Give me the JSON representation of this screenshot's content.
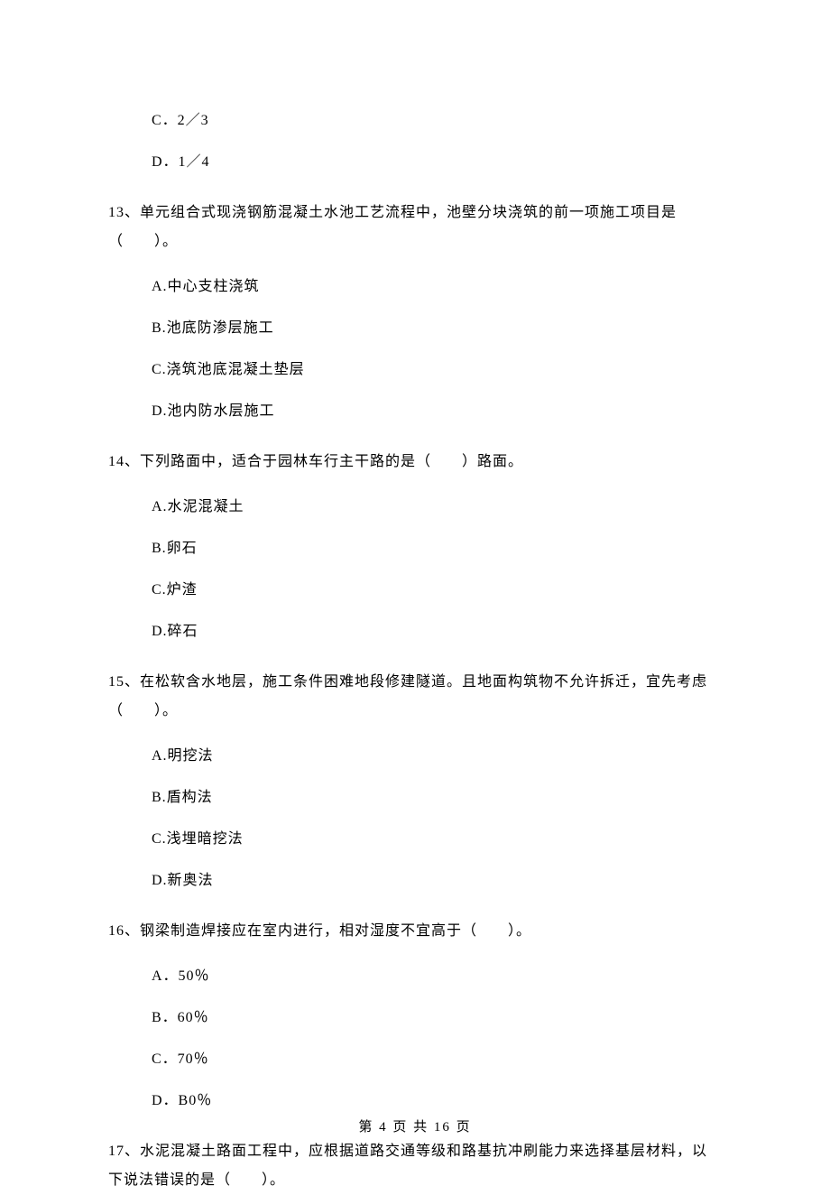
{
  "orphan_options": {
    "c": "C．2／3",
    "d": "D．1／4"
  },
  "questions": [
    {
      "num": "13、",
      "text": "单元组合式现浇钢筋混凝土水池工艺流程中，池壁分块浇筑的前一项施工项目是（　　）。",
      "options": {
        "a": "A.中心支柱浇筑",
        "b": "B.池底防渗层施工",
        "c": "C.浇筑池底混凝土垫层",
        "d": "D.池内防水层施工"
      }
    },
    {
      "num": "14、",
      "text": "下列路面中，适合于园林车行主干路的是（　　）路面。",
      "options": {
        "a": "A.水泥混凝土",
        "b": "B.卵石",
        "c": "C.炉渣",
        "d": "D.碎石"
      }
    },
    {
      "num": "15、",
      "text": "在松软含水地层，施工条件困难地段修建隧道。且地面构筑物不允许拆迁，宜先考虑（　　）。",
      "options": {
        "a": "A.明挖法",
        "b": "B.盾构法",
        "c": "C.浅埋暗挖法",
        "d": "D.新奥法"
      }
    },
    {
      "num": "16、",
      "text": "钢梁制造焊接应在室内进行，相对湿度不宜高于（　　）。",
      "options": {
        "a": "A．50％",
        "b": "B．60％",
        "c": "C．70％",
        "d": "D．B0％"
      }
    },
    {
      "num": "17、",
      "text": "水泥混凝土路面工程中，应根据道路交通等级和路基抗冲刷能力来选择基层材料，以下说法错误的是（　　）。",
      "options": {}
    }
  ],
  "footer": "第 4 页 共 16 页"
}
